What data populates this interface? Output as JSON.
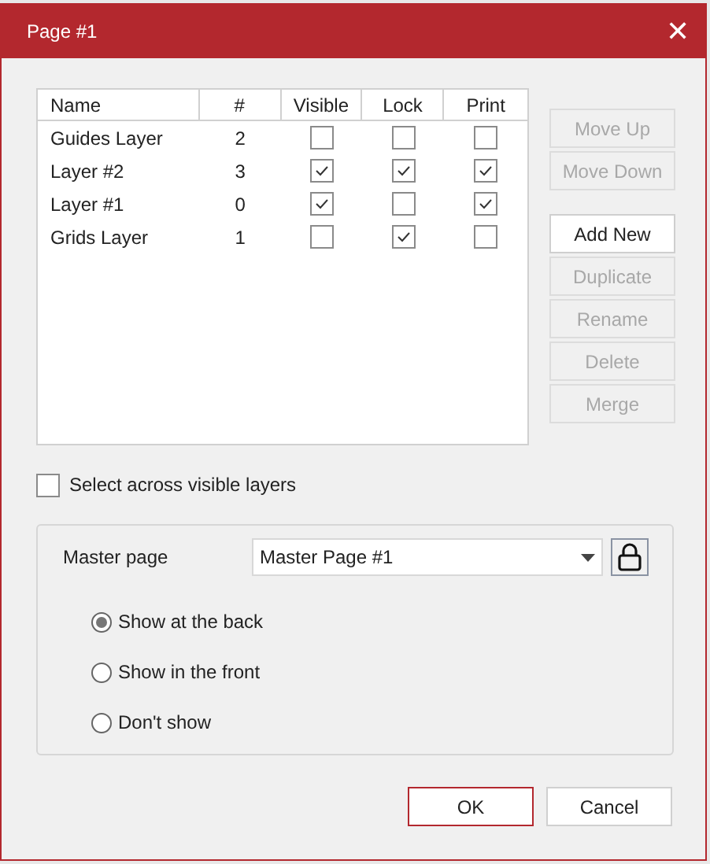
{
  "window": {
    "title": "Page #1",
    "close": "✕"
  },
  "table": {
    "columns": [
      "Name",
      "#",
      "Visible",
      "Lock",
      "Print"
    ],
    "rows": [
      {
        "name": "Guides Layer",
        "number": "2",
        "visible": false,
        "lock": false,
        "print": false
      },
      {
        "name": "Layer #2",
        "number": "3",
        "visible": true,
        "lock": true,
        "print": true
      },
      {
        "name": "Layer #1",
        "number": "0",
        "visible": true,
        "lock": false,
        "print": true
      },
      {
        "name": "Grids Layer",
        "number": "1",
        "visible": false,
        "lock": true,
        "print": false
      }
    ]
  },
  "side_buttons": [
    [
      {
        "label": "Move Up",
        "disabled": true
      },
      {
        "label": "Move Down",
        "disabled": true
      }
    ],
    [
      {
        "label": "Add New",
        "disabled": false
      },
      {
        "label": "Duplicate",
        "disabled": true
      },
      {
        "label": "Rename",
        "disabled": true
      },
      {
        "label": "Delete",
        "disabled": true
      },
      {
        "label": "Merge",
        "disabled": true
      }
    ]
  ],
  "select_across": {
    "label": "Select across visible layers",
    "checked": false
  },
  "master_page": {
    "label": "Master page",
    "value": "Master Page #1",
    "options": [
      {
        "label": "Show at the back",
        "selected": true
      },
      {
        "label": "Show in the front",
        "selected": false
      },
      {
        "label": "Don't show",
        "selected": false
      }
    ]
  },
  "buttons": [
    {
      "label": "OK",
      "default": true
    },
    {
      "label": "Cancel",
      "default": false
    }
  ]
}
